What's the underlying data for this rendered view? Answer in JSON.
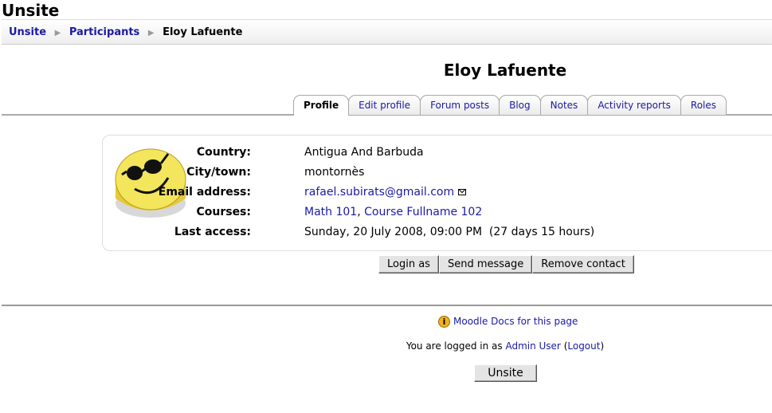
{
  "site": {
    "title": "Unsite"
  },
  "breadcrumb": {
    "items": [
      "Unsite",
      "Participants"
    ],
    "current": "Eloy Lafuente"
  },
  "user": {
    "fullname": "Eloy Lafuente"
  },
  "tabs": [
    {
      "label": "Profile",
      "active": true
    },
    {
      "label": "Edit profile"
    },
    {
      "label": "Forum posts"
    },
    {
      "label": "Blog"
    },
    {
      "label": "Notes"
    },
    {
      "label": "Activity reports"
    },
    {
      "label": "Roles"
    }
  ],
  "profile": {
    "avatar_icon": "smiley-sunglasses-icon",
    "fields": [
      {
        "label": "Country:",
        "value": "Antigua And Barbuda"
      },
      {
        "label": "City/town:",
        "value": "montornès"
      },
      {
        "label": "Email address:",
        "value": "rafael.subirats@gmail.com",
        "icon": "mail-icon"
      },
      {
        "label": "Courses:",
        "courses": [
          "Math 101",
          "Course Fullname 102"
        ]
      },
      {
        "label": "Last access:",
        "value": "Sunday, 20 July 2008, 09:00 PM  (27 days 15 hours)"
      }
    ]
  },
  "actions": {
    "login_as": "Login as",
    "send_message": "Send message",
    "remove_contact": "Remove contact"
  },
  "footer": {
    "docs_link": "Moodle Docs for this page",
    "logged_in_prefix": "You are logged in as ",
    "user_link": "Admin User",
    "logout_link": "Logout",
    "home_button": "Unsite"
  },
  "colors": {
    "link": "#1a1aa6",
    "avatar_face": "#f3e55c",
    "info_icon": "#f2b21c"
  }
}
